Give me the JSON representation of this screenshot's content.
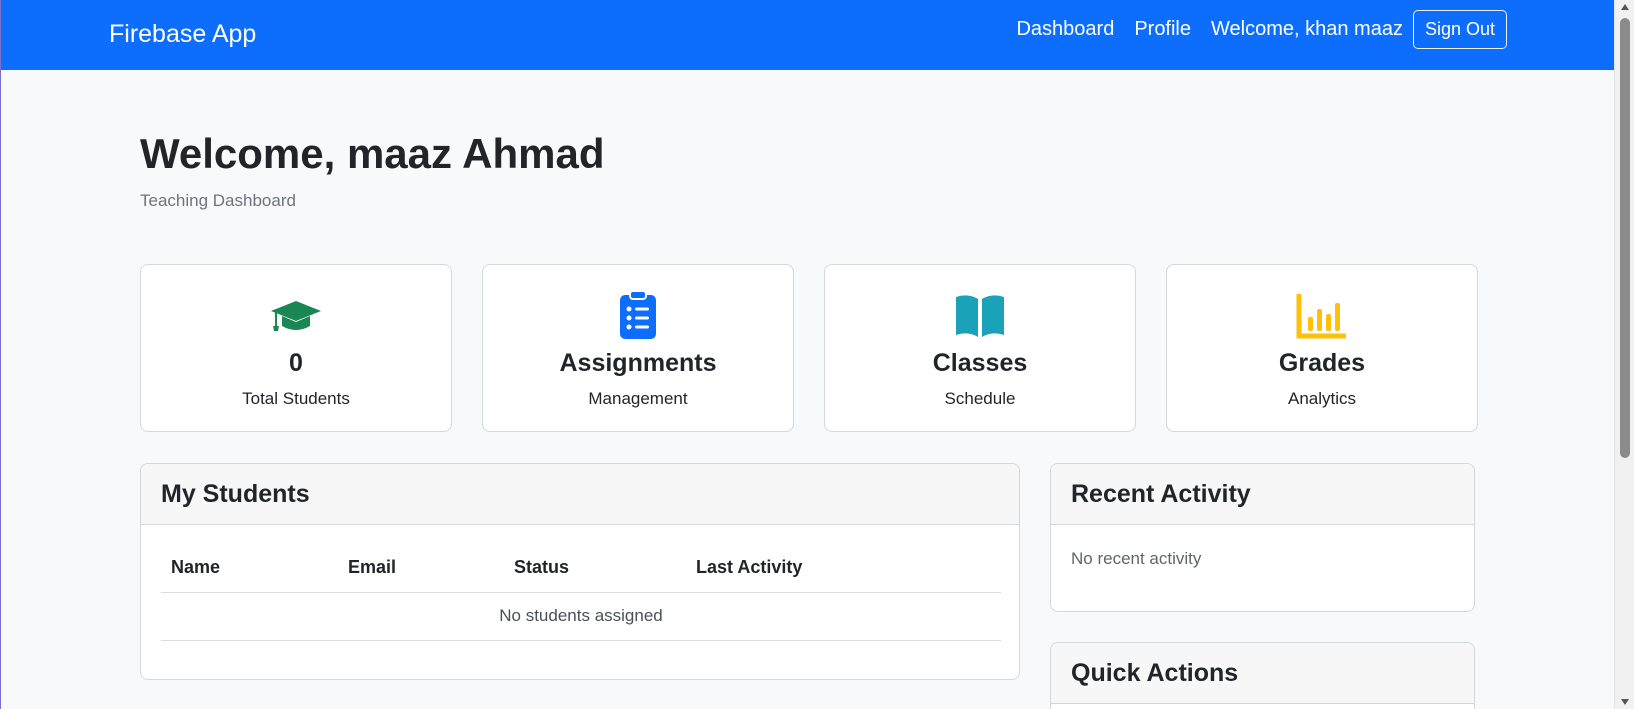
{
  "navbar": {
    "brand": "Firebase App",
    "links": [
      "Dashboard",
      "Profile"
    ],
    "welcome": "Welcome, khan maaz",
    "signout": "Sign Out",
    "background": "#0d6efd"
  },
  "header": {
    "title": "Welcome, maaz Ahmad",
    "subtitle": "Teaching Dashboard"
  },
  "stats": [
    {
      "icon": "graduation-cap-icon",
      "value": "0",
      "label": "Total Students",
      "color": "#198754"
    },
    {
      "icon": "clipboard-list-icon",
      "value": "Assignments",
      "label": "Management",
      "color": "#0d6efd"
    },
    {
      "icon": "open-book-icon",
      "value": "Classes",
      "label": "Schedule",
      "color": "#1aa2b8"
    },
    {
      "icon": "bar-chart-icon",
      "value": "Grades",
      "label": "Analytics",
      "color": "#ffc107"
    }
  ],
  "students_panel": {
    "title": "My Students",
    "columns": [
      "Name",
      "Email",
      "Status",
      "Last Activity"
    ],
    "empty_message": "No students assigned"
  },
  "activity_panel": {
    "title": "Recent Activity",
    "empty_message": "No recent activity"
  },
  "quick_actions_panel": {
    "title": "Quick Actions"
  }
}
